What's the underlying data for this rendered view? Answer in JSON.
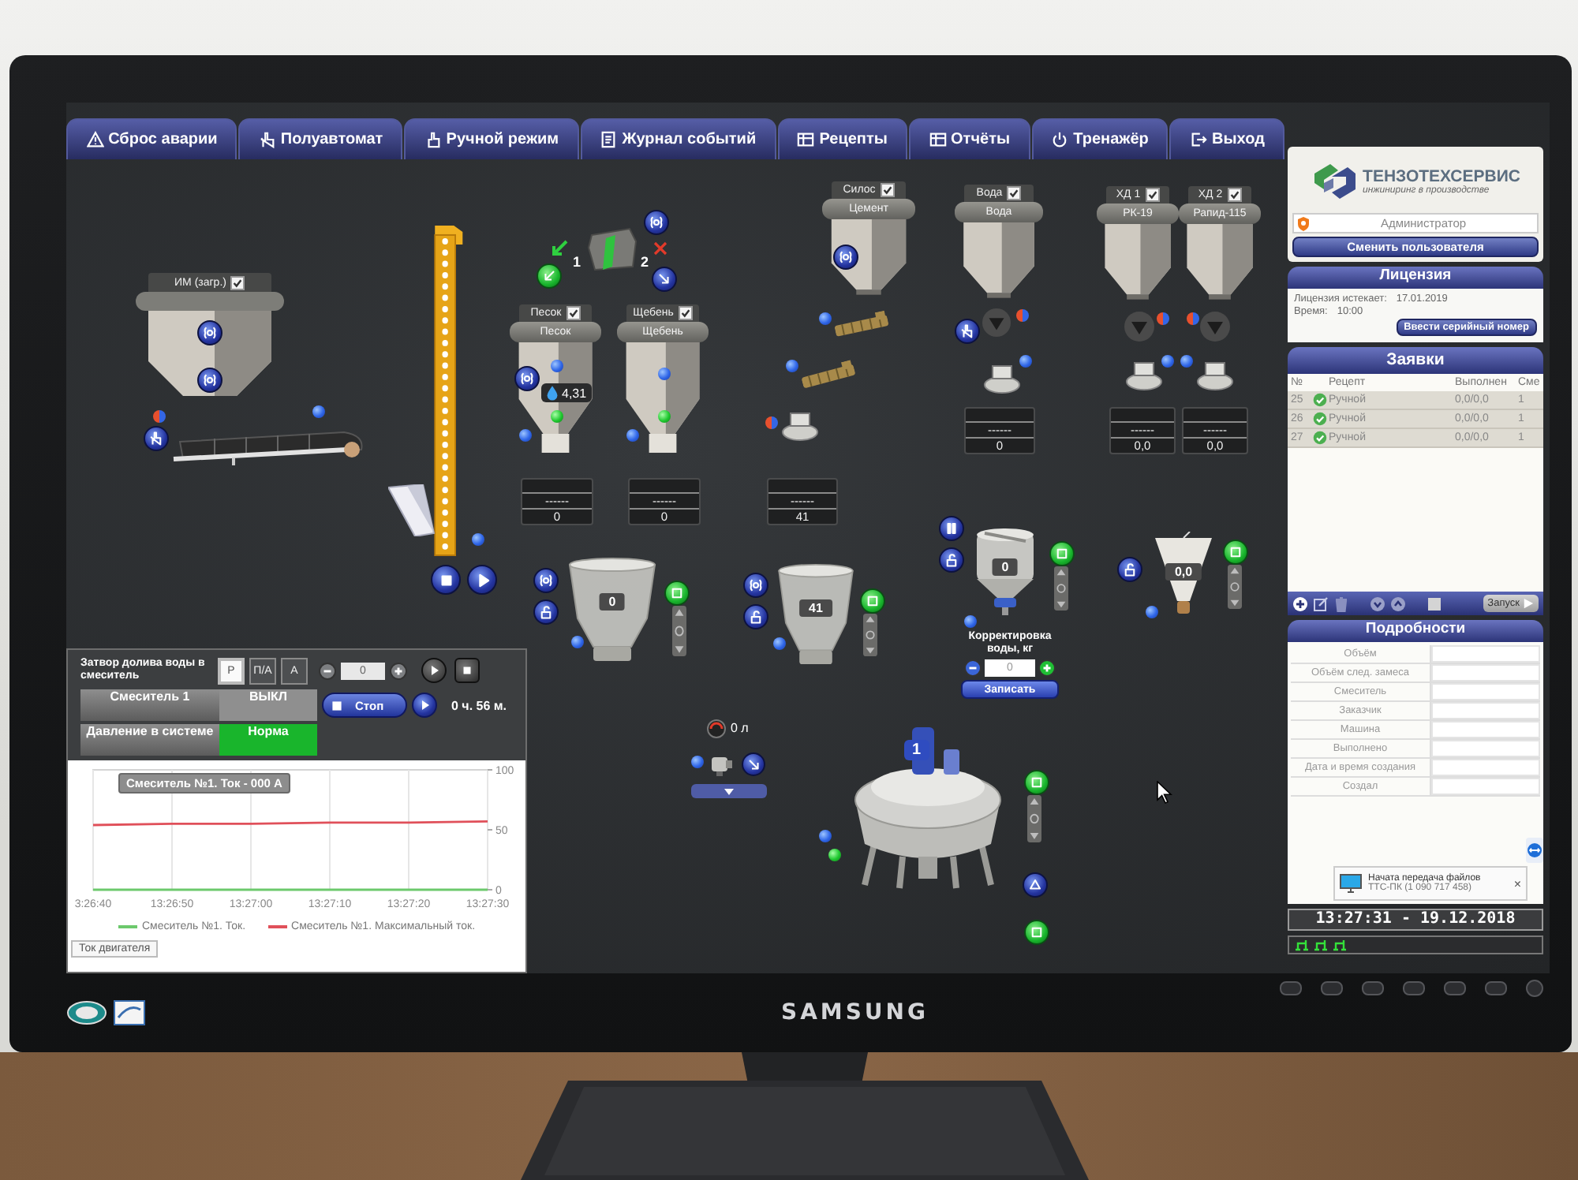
{
  "tabs": [
    {
      "label": "Сброс аварии"
    },
    {
      "label": "Полуавтомат"
    },
    {
      "label": "Ручной режим"
    },
    {
      "label": "Журнал событий"
    },
    {
      "label": "Рецепты"
    },
    {
      "label": "Отчёты"
    },
    {
      "label": "Тренажёр"
    },
    {
      "label": "Выход"
    }
  ],
  "loader": {
    "title": "ИМ (загр.)",
    "checked": true
  },
  "gate_switch": {
    "positions": [
      "1",
      "2"
    ]
  },
  "bins": [
    {
      "title": "Песок",
      "material": "Песок",
      "checked": true,
      "moisture": "4,31",
      "readout": {
        "status": "------",
        "value": "0"
      }
    },
    {
      "title": "Щебень",
      "material": "Щебень",
      "checked": true,
      "readout": {
        "status": "------",
        "value": "0"
      }
    }
  ],
  "silo": {
    "title": "Силос",
    "material": "Цемент",
    "checked": true,
    "readout": {
      "status": "------",
      "value": "41"
    }
  },
  "water_tank": {
    "title": "Вода",
    "material": "Вода",
    "checked": true,
    "readout": {
      "status": "------",
      "value": "0"
    }
  },
  "additive_tanks": [
    {
      "title": "ХД 1",
      "material": "РК-19",
      "checked": true,
      "readout": {
        "status": "------",
        "value": "0,0"
      }
    },
    {
      "title": "ХД 2",
      "material": "Рапид-115",
      "checked": true,
      "readout": {
        "status": "------",
        "value": "0,0"
      }
    }
  ],
  "weigh_hoppers": [
    {
      "kind": "aggregate",
      "value": "0"
    },
    {
      "kind": "cement",
      "value": "41"
    },
    {
      "kind": "water",
      "value": "0"
    },
    {
      "kind": "additive",
      "value": "0,0"
    }
  ],
  "water_correction": {
    "label": "Корректировка воды, кг",
    "placeholder": "0",
    "button": "Записать"
  },
  "mixer": {
    "number": "1",
    "water_volume": "0 л"
  },
  "mixer_panel": {
    "valve_label": "Затвор долива воды в смеситель",
    "modes": [
      {
        "label": "Р",
        "selected": true
      },
      {
        "label": "П/А",
        "selected": false
      },
      {
        "label": "А",
        "selected": false
      }
    ],
    "valve_value": "0",
    "states": [
      {
        "name": "Смеситель 1",
        "value": "ВЫКЛ",
        "color": "#8f8f8f"
      },
      {
        "name": "Давление в системе",
        "value": "Норма",
        "color": "#19b52c"
      }
    ],
    "stop_button": "Стоп",
    "runtime": "0 ч. 56 м.",
    "tooltip": "Смеситель №1. Ток - 000 А",
    "tab": "Ток двигателя",
    "chart_data": {
      "type": "line",
      "categories": [
        "3:26:40",
        "13:26:50",
        "13:27:00",
        "13:27:10",
        "13:27:20",
        "13:27:30"
      ],
      "series": [
        {
          "name": "Смеситель №1. Ток.",
          "color": "#6cc96c",
          "values": [
            0,
            0,
            0,
            0,
            0,
            0
          ]
        },
        {
          "name": "Смеситель №1. Максимальный ток.",
          "color": "#e0505a",
          "values": [
            54,
            55,
            55,
            56,
            56,
            57
          ]
        }
      ],
      "ylim": [
        0,
        100
      ],
      "yticks": [
        0,
        50,
        100
      ],
      "grid": true
    }
  },
  "sidebar": {
    "logo": {
      "name": "ТЕНЗОТЕХСЕРВИС",
      "tagline": "инжиниринг в производстве"
    },
    "user": "Администратор",
    "switch_user": "Сменить пользователя",
    "license": {
      "title": "Лицензия",
      "lines": [
        {
          "label": "Лицензия истекает:",
          "value": "17.01.2019"
        },
        {
          "label": "Время:",
          "value": "10:00"
        }
      ],
      "button": "Ввести серийный номер"
    },
    "orders": {
      "title": "Заявки",
      "columns": [
        "№",
        "Рецепт",
        "Выполнен",
        "Сме"
      ],
      "rows": [
        {
          "number": "25",
          "done": true,
          "recipe": "Ручной",
          "progress": "0,0/0,0",
          "mixer": "1"
        },
        {
          "number": "26",
          "done": true,
          "recipe": "Ручной",
          "progress": "0,0/0,0",
          "mixer": "1"
        },
        {
          "number": "27",
          "done": true,
          "recipe": "Ручной",
          "progress": "0,0/0,0",
          "mixer": "1"
        }
      ],
      "start": "Запуск"
    },
    "details": {
      "title": "Подробности",
      "fields": [
        "Объём",
        "Объём след. замеса",
        "Смеситель",
        "Заказчик",
        "Машина",
        "Выполнено",
        "Дата и время создания",
        "Создал"
      ]
    },
    "notification": {
      "title": "Начата передача файлов",
      "text": "ТТС-ПК (1 090 717 458)",
      "close": "×"
    },
    "clock": "13:27:31 - 19.12.2018"
  },
  "monitor": {
    "brand": "SAMSUNG"
  }
}
